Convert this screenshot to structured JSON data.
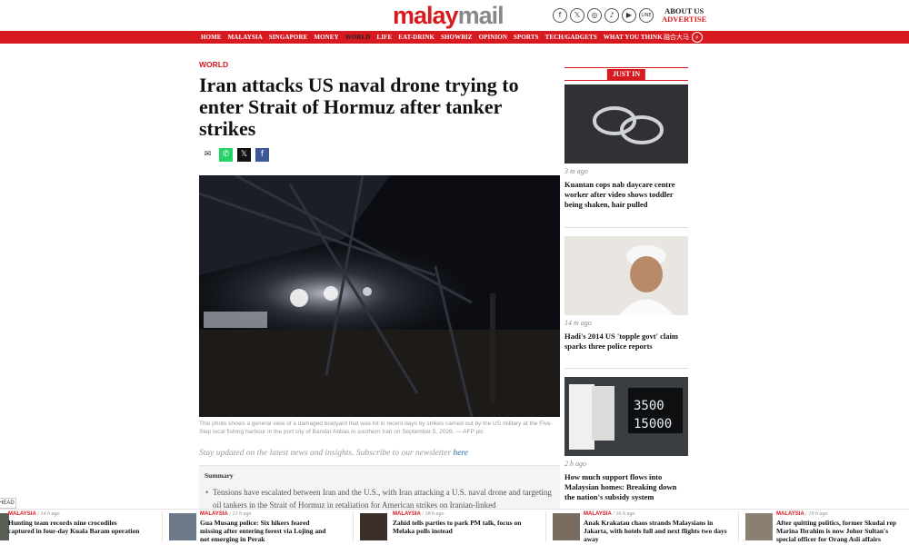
{
  "header": {
    "logo_part1": "malay",
    "logo_part2": "mail",
    "social_icons": [
      "facebook-icon",
      "x-icon",
      "instagram-icon",
      "tiktok-icon",
      "youtube-icon",
      "line-icon"
    ],
    "about_label": "ABOUT US",
    "advertise_label": "ADVERTISE"
  },
  "nav": {
    "items": [
      "HOME",
      "MALAYSIA",
      "SINGAPORE",
      "MONEY",
      "WORLD",
      "LIFE",
      "EAT-DRINK",
      "SHOWBIZ",
      "OPINION",
      "SPORTS",
      "TECH/GADGETS",
      "WHAT YOU THINK"
    ],
    "active": "WORLD",
    "chinese_label": "融合大马",
    "accent_color": "#d71920"
  },
  "article": {
    "section": "WORLD",
    "headline": "Iran attacks US naval drone trying to enter Strait of Hormuz after tanker strikes",
    "caption": "This photo shows a general view of a damaged boatyard that was hit in recent days by strikes carried out by the US military at the Five-Step local fishing harbour in the port city of Bandar Abbas in southern Iran on September 5, 2026. — AFP pic",
    "stay_text": "Stay updated on the latest news and insights. Subscribe to our newsletter",
    "stay_link": "here",
    "summary_title": "Summary",
    "summary_text": "Tensions have escalated between Iran and the U.S., with Iran attacking a U.S. naval drone and targeting oil tankers in the Strait of Hormuz in retaliation for American strikes on Iranian-linked"
  },
  "sidebar": {
    "label": "JUST IN",
    "items": [
      {
        "time": "3 m ago",
        "title": "Kuantan cops nab daycare centre worker after video shows toddler being shaken, hair pulled"
      },
      {
        "time": "14 m ago",
        "title": "Hadi's 2014 US 'topple govt' claim sparks three police reports"
      },
      {
        "time": "2 h ago",
        "title": "How much support flows into Malaysian homes: Breaking down the nation's subsidy system"
      }
    ]
  },
  "bottom": {
    "tab_label": "HEAD",
    "items": [
      {
        "category": "MALAYSIA",
        "time": "14 h ago",
        "title": "Hunting team records nine crocodiles captured in four-day Kuala Baram operation"
      },
      {
        "category": "MALAYSIA",
        "time": "13 h ago",
        "title": "Gua Musang police: Six hikers feared missing after entering forest via Lojing and not emerging in Perak"
      },
      {
        "category": "MALAYSIA",
        "time": "18 h ago",
        "title": "Zahid tells parties to park PM talk, focus on Melaka polls instead"
      },
      {
        "category": "MALAYSIA",
        "time": "16 h ago",
        "title": "Anak Krakatau chaos strands Malaysians in Jakarta, with hotels full and next flights two days away"
      },
      {
        "category": "MALAYSIA",
        "time": "19 h ago",
        "title": "After quitting politics, former Skudai rep Marina Ibrahim is now Johor Sultan's special officer for Orang Asli affairs"
      }
    ]
  }
}
